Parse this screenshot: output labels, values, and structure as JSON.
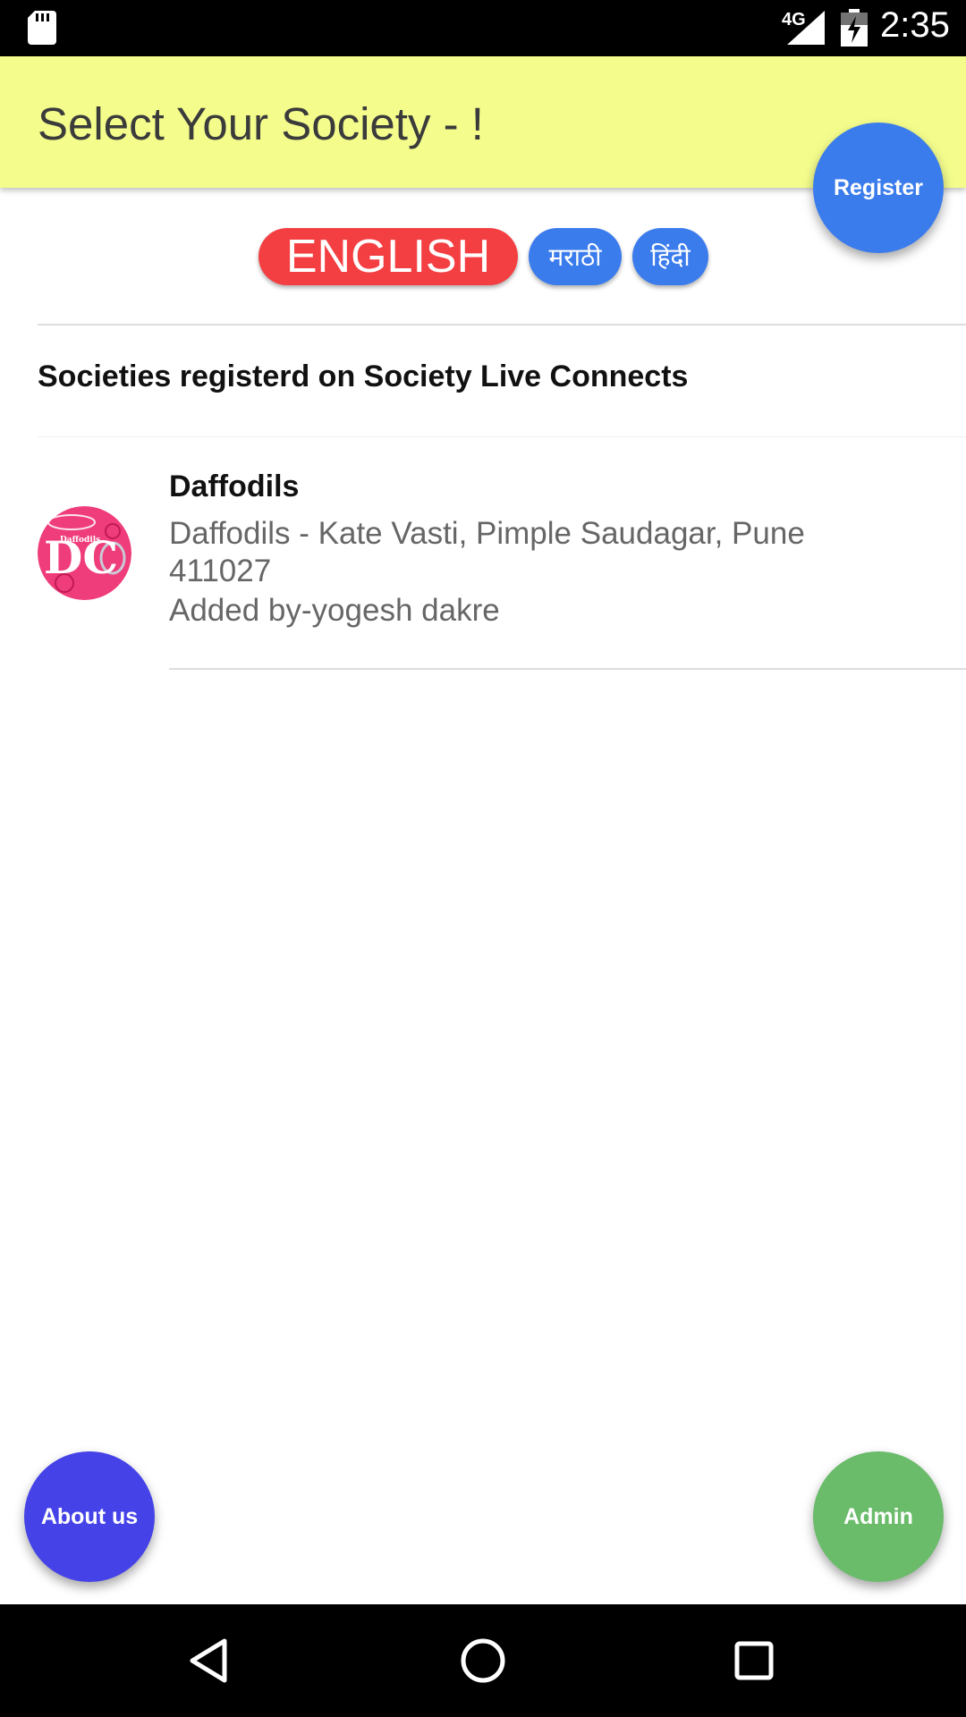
{
  "status_bar": {
    "time": "2:35",
    "network": "4G",
    "icons": [
      "sd-card-icon",
      "signal-icon",
      "battery-charging-icon"
    ]
  },
  "app_bar": {
    "title": "Select Your Society - !"
  },
  "fabs": {
    "register": "Register",
    "about": "About us",
    "admin": "Admin"
  },
  "languages": {
    "english": "ENGLISH",
    "marathi": "मराठी",
    "hindi": "हिंदी",
    "selected": "english"
  },
  "section": {
    "title": "Societies registerd on Society Live Connects"
  },
  "societies": [
    {
      "name": "Daffodils",
      "address": "Daffodils - Kate Vasti, Pimple Saudagar, Pune 411027",
      "added_by": "Added by-yogesh dakre",
      "avatar_text": "DC",
      "avatar_caption": "Daffodils"
    }
  ],
  "navigation": {
    "icons": [
      "back-icon",
      "home-icon",
      "recents-icon"
    ]
  },
  "colors": {
    "app_bar": "#f4fd8c",
    "register": "#3b7ced",
    "english_chip": "#f43f42",
    "lang_chip": "#3b7ced",
    "about": "#4542e8",
    "admin": "#6abb6a",
    "avatar": "#ef3c7a"
  }
}
